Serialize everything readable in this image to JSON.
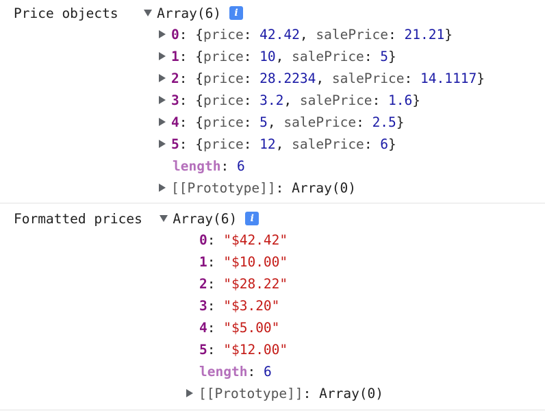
{
  "console": {
    "groups": [
      {
        "label": "Price objects",
        "array_summary": "Array(6)",
        "info_icon": "i",
        "entries": [
          {
            "index": "0",
            "price_key": "price",
            "price": "42.42",
            "sale_key": "salePrice",
            "sale": "21.21"
          },
          {
            "index": "1",
            "price_key": "price",
            "price": "10",
            "sale_key": "salePrice",
            "sale": "5"
          },
          {
            "index": "2",
            "price_key": "price",
            "price": "28.2234",
            "sale_key": "salePrice",
            "sale": "14.1117"
          },
          {
            "index": "3",
            "price_key": "price",
            "price": "3.2",
            "sale_key": "salePrice",
            "sale": "1.6"
          },
          {
            "index": "4",
            "price_key": "price",
            "price": "5",
            "sale_key": "salePrice",
            "sale": "2.5"
          },
          {
            "index": "5",
            "price_key": "price",
            "price": "12",
            "sale_key": "salePrice",
            "sale": "6"
          }
        ],
        "length_key": "length",
        "length_value": "6",
        "prototype_key": "[[Prototype]]",
        "prototype_value": "Array(0)"
      },
      {
        "label": "Formatted prices",
        "array_summary": "Array(6)",
        "info_icon": "i",
        "entries": [
          {
            "index": "0",
            "value": "\"$42.42\""
          },
          {
            "index": "1",
            "value": "\"$10.00\""
          },
          {
            "index": "2",
            "value": "\"$28.22\""
          },
          {
            "index": "3",
            "value": "\"$3.20\""
          },
          {
            "index": "4",
            "value": "\"$5.00\""
          },
          {
            "index": "5",
            "value": "\"$12.00\""
          }
        ],
        "length_key": "length",
        "length_value": "6",
        "prototype_key": "[[Prototype]]",
        "prototype_value": "Array(0)"
      }
    ]
  },
  "icons": {
    "expanded": "triangle-down-icon",
    "collapsed": "triangle-right-icon",
    "info": "info-icon"
  },
  "colors": {
    "key": "#881280",
    "length_key": "#b46fbb",
    "number": "#1a1aa6",
    "string": "#c41a16",
    "info_badge": "#4a8af4"
  }
}
